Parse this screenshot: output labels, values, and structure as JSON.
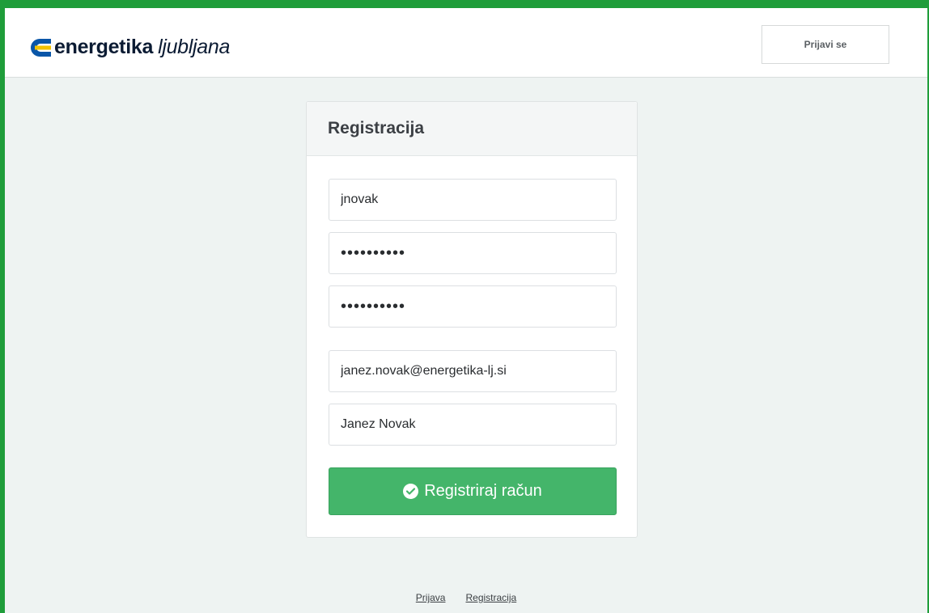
{
  "header": {
    "logo_bold": "energetika",
    "logo_light": "ljubljana",
    "login_button": "Prijavi se"
  },
  "form": {
    "title": "Registracija",
    "username_value": "jnovak",
    "password_value": "••••••••••",
    "password_confirm_value": "••••••••••",
    "email_value": "janez.novak@energetika-lj.si",
    "fullname_value": "Janez Novak",
    "submit_label": "Registriraj račun"
  },
  "footer": {
    "links": [
      "Prijava",
      "Registracija"
    ]
  },
  "colors": {
    "accent_green": "#44b56a",
    "frame_green": "#1f9d3a",
    "logo_blue": "#0a56a8",
    "logo_yellow": "#f2c200"
  }
}
